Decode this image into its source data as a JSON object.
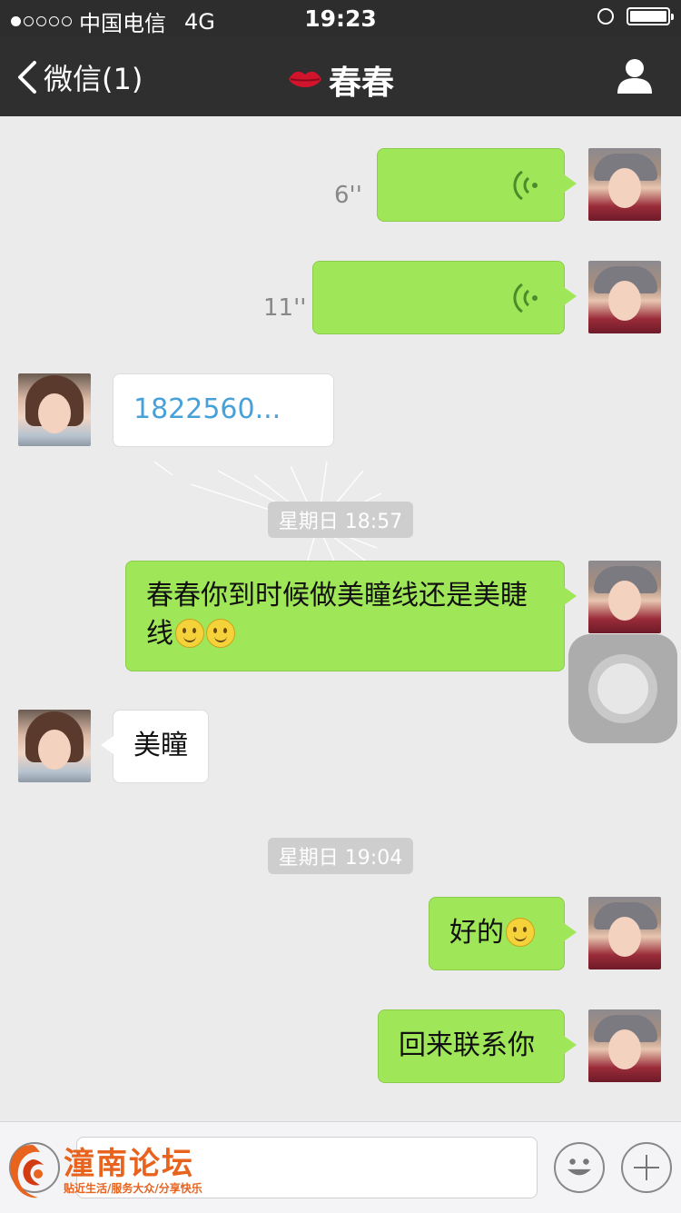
{
  "status_bar": {
    "carrier": "中国电信",
    "network": "4G",
    "time": "19:23"
  },
  "nav": {
    "back_label": "微信(1)",
    "contact_name": "春春",
    "icons": {
      "back": "chevron-left-icon",
      "lips": "lips-icon",
      "profile": "person-icon"
    }
  },
  "messages": [
    {
      "from": "me",
      "type": "voice",
      "duration": "6''"
    },
    {
      "from": "me",
      "type": "voice",
      "duration": "11''"
    },
    {
      "from": "them",
      "type": "text",
      "text": "1822560..."
    },
    {
      "timestamp": "星期日 18:57"
    },
    {
      "from": "me",
      "type": "text",
      "text": "春春你到时候做美瞳线还是美睫线"
    },
    {
      "from": "them",
      "type": "text",
      "text": "美瞳"
    },
    {
      "timestamp": "星期日 19:04"
    },
    {
      "from": "me",
      "type": "text",
      "text": "好的"
    },
    {
      "from": "me",
      "type": "text",
      "text": "回来联系你"
    }
  ],
  "input_bar": {
    "icons": {
      "voice": "voice-toggle-icon",
      "emoji": "emoji-face-icon",
      "more": "plus-icon"
    }
  },
  "watermark": {
    "title": "潼南论坛",
    "subtitle": "贴近生活/服务大众/分享快乐"
  },
  "colors": {
    "nav_bg": "#2f2f2f",
    "chat_bg": "#ebebeb",
    "my_bubble": "#9fe658",
    "their_bubble": "#ffffff",
    "watermark": "#e8631e"
  }
}
